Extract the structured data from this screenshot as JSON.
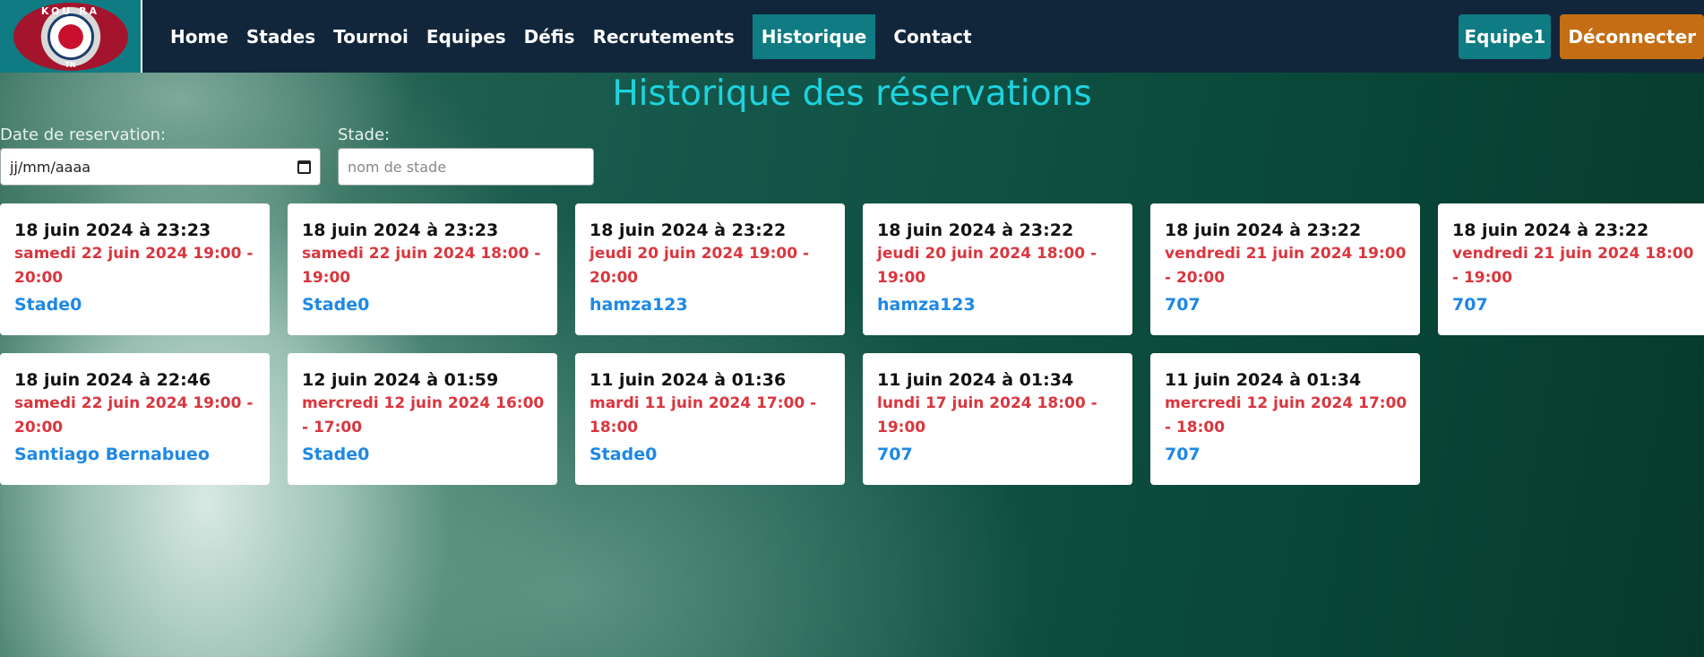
{
  "brand": {
    "logo_text": "KOU RA",
    "logo_sub": "TN"
  },
  "nav": {
    "items": [
      {
        "label": "Home"
      },
      {
        "label": "Stades"
      },
      {
        "label": "Tournoi"
      },
      {
        "label": "Equipes"
      },
      {
        "label": "Défis"
      },
      {
        "label": "Recrutements"
      },
      {
        "label": "Historique",
        "active": true
      },
      {
        "label": "Contact"
      }
    ],
    "team_label": "Equipe1",
    "logout_label": "Déconnecter"
  },
  "page": {
    "title": "Historique des réservations"
  },
  "filters": {
    "date_label": "Date de reservation:",
    "date_value": "jj/mm/aaaa",
    "stade_label": "Stade:",
    "stade_placeholder": "nom de stade"
  },
  "reservations": [
    {
      "created": "18 juin 2024 à 23:23",
      "slot": "samedi 22 juin 2024 19:00 - 20:00",
      "stade": "Stade0"
    },
    {
      "created": "18 juin 2024 à 23:23",
      "slot": "samedi 22 juin 2024 18:00 - 19:00",
      "stade": "Stade0"
    },
    {
      "created": "18 juin 2024 à 23:22",
      "slot": "jeudi 20 juin 2024 19:00 - 20:00",
      "stade": "hamza123"
    },
    {
      "created": "18 juin 2024 à 23:22",
      "slot": "jeudi 20 juin 2024 18:00 - 19:00",
      "stade": "hamza123"
    },
    {
      "created": "18 juin 2024 à 23:22",
      "slot": "vendredi 21 juin 2024 19:00 - 20:00",
      "stade": "707"
    },
    {
      "created": "18 juin 2024 à 23:22",
      "slot": "vendredi 21 juin 2024 18:00 - 19:00",
      "stade": "707"
    },
    {
      "created": "18 juin 2024 à 22:46",
      "slot": "samedi 22 juin 2024 19:00 - 20:00",
      "stade": "Santiago Bernabueo"
    },
    {
      "created": "12 juin 2024 à 01:59",
      "slot": "mercredi 12 juin 2024 16:00 - 17:00",
      "stade": "Stade0"
    },
    {
      "created": "11 juin 2024 à 01:36",
      "slot": "mardi 11 juin 2024 17:00 - 18:00",
      "stade": "Stade0"
    },
    {
      "created": "11 juin 2024 à 01:34",
      "slot": "lundi 17 juin 2024 18:00 - 19:00",
      "stade": "707"
    },
    {
      "created": "11 juin 2024 à 01:34",
      "slot": "mercredi 12 juin 2024 17:00 - 18:00",
      "stade": "707"
    }
  ],
  "colors": {
    "navbar": "#12263b",
    "accent": "#0f7b82",
    "title": "#1dd3df",
    "logout": "#c46d12",
    "slot_text": "#d9363e",
    "stade_text": "#1e88e5"
  }
}
